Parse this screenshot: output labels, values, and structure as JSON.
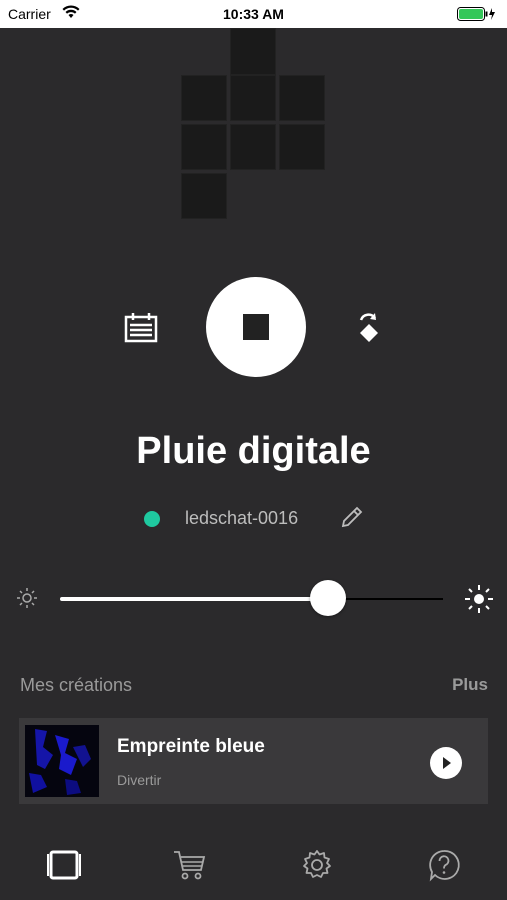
{
  "status_bar": {
    "carrier": "Carrier",
    "time": "10:33 AM"
  },
  "now_playing": {
    "title": "Pluie digitale"
  },
  "device": {
    "name": "ledschat-0016",
    "status_color": "#1fc9a0"
  },
  "brightness": {
    "level": 0.7
  },
  "creations": {
    "title": "Mes créations",
    "more_label": "Plus",
    "items": [
      {
        "name": "Empreinte bleue",
        "category": "Divertir"
      }
    ]
  },
  "tabbar": {
    "icons": [
      "frame-icon",
      "cart-icon",
      "gear-icon",
      "help-icon"
    ]
  },
  "colors": {
    "background": "#2b2a2c",
    "accent": "#1fc9a0",
    "card": "#3a393b"
  }
}
